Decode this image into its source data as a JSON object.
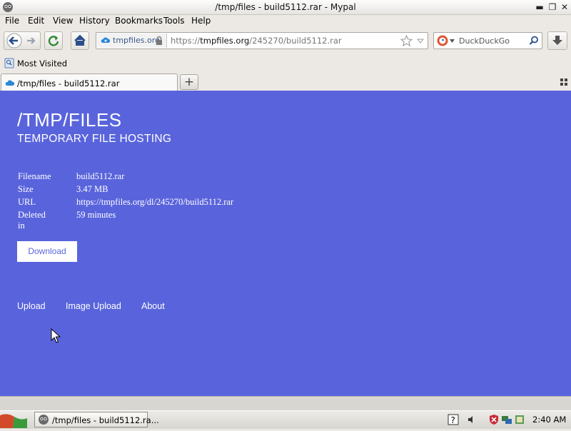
{
  "window": {
    "title": "/tmp/files - build5112.rar - Mypal",
    "minimize": "▬",
    "restore": "❐",
    "close": "✕"
  },
  "menu": {
    "file": "File",
    "edit": "Edit",
    "view": "View",
    "history": "History",
    "bookmarks": "Bookmarks",
    "tools": "Tools",
    "help": "Help"
  },
  "nav": {
    "identity_domain": "tmpfiles.org",
    "url_scheme": "https://",
    "url_host": "tmpfiles.org",
    "url_path": "/245270/build5112.rar",
    "search_engine_name": "DuckDuckGo",
    "search_placeholder": "DuckDuckGo"
  },
  "bookmarks_bar": {
    "most_visited": "Most Visited"
  },
  "tab": {
    "label": "/tmp/files - build5112.rar",
    "new_tab": "+"
  },
  "page": {
    "title": "/TMP/FILES",
    "subtitle": "TEMPORARY FILE HOSTING",
    "info": [
      {
        "key": "Filename",
        "value": "build5112.rar"
      },
      {
        "key": "Size",
        "value": "3.47 MB"
      },
      {
        "key": "URL",
        "value": "https://tmpfiles.org/dl/245270/build5112.rar"
      },
      {
        "key": "Deleted in",
        "value": "59 minutes"
      }
    ],
    "download_button": "Download",
    "footer_links": {
      "upload": "Upload",
      "image_upload": "Image Upload",
      "about": "About"
    },
    "background_color": "#5964dc"
  },
  "taskbar": {
    "window_item": "/tmp/files - build5112.ra...",
    "clock": "2:40 AM"
  }
}
